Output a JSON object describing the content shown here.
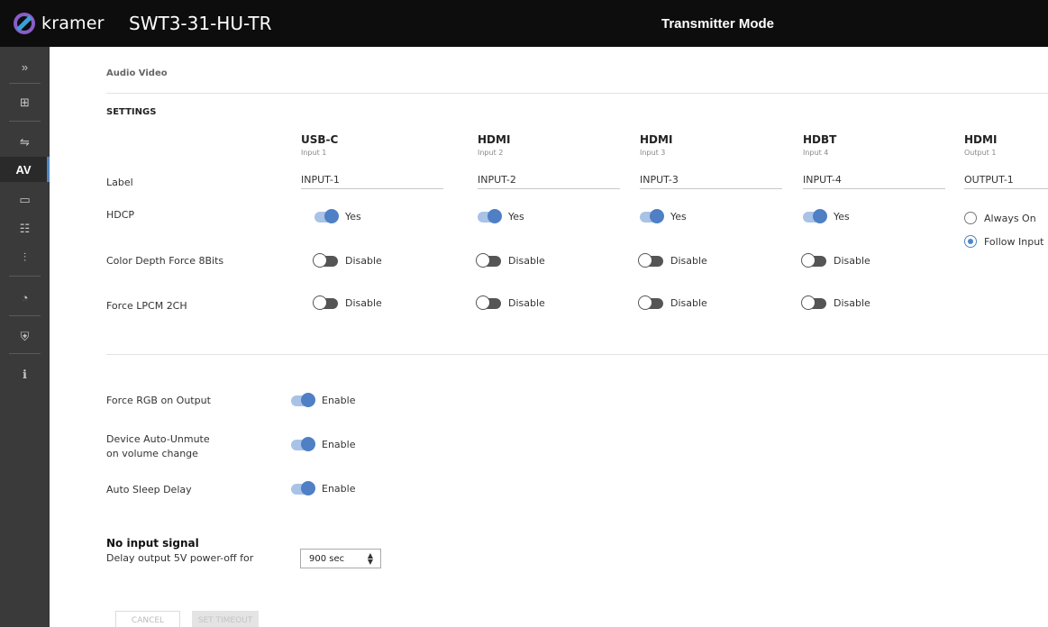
{
  "header": {
    "brand": "kramer",
    "device_name": "SWT3-31-HU-TR",
    "mode": "Transmitter Mode"
  },
  "sidebar": {
    "items": [
      {
        "icon": "chevron-double-right-icon",
        "glyph": "»"
      },
      {
        "icon": "routing-icon",
        "glyph": "⊞"
      },
      {
        "icon": "switching-icon",
        "glyph": "⇋"
      },
      {
        "icon": "av-icon",
        "glyph": "AV",
        "active": true
      },
      {
        "icon": "display-icon",
        "glyph": "▭"
      },
      {
        "icon": "device-settings-icon",
        "glyph": "☷"
      },
      {
        "icon": "audio-settings-icon",
        "glyph": "⫶"
      },
      {
        "icon": "diagnostics-icon",
        "glyph": "◔"
      },
      {
        "icon": "security-icon",
        "glyph": "⛨"
      },
      {
        "icon": "info-icon",
        "glyph": "ℹ"
      }
    ]
  },
  "main": {
    "breadcrumb": "Audio Video",
    "settings_title": "SETTINGS",
    "row_labels": {
      "label": "Label",
      "hdcp": "HDCP",
      "color_depth": "Color Depth Force 8Bits",
      "force_lpcm": "Force LPCM 2CH"
    },
    "columns": [
      {
        "title": "USB-C",
        "subtitle": "Input 1",
        "label_value": "INPUT-1",
        "hdcp": "Yes",
        "color_depth": "Disable",
        "force_lpcm": "Disable"
      },
      {
        "title": "HDMI",
        "subtitle": "Input 2",
        "label_value": "INPUT-2",
        "hdcp": "Yes",
        "color_depth": "Disable",
        "force_lpcm": "Disable"
      },
      {
        "title": "HDMI",
        "subtitle": "Input 3",
        "label_value": "INPUT-3",
        "hdcp": "Yes",
        "color_depth": "Disable",
        "force_lpcm": "Disable"
      },
      {
        "title": "HDBT",
        "subtitle": "Input 4",
        "label_value": "INPUT-4",
        "hdcp": "Yes",
        "color_depth": "Disable",
        "force_lpcm": "Disable"
      }
    ],
    "output_column": {
      "title": "HDMI",
      "subtitle": "Output 1",
      "label_value": "OUTPUT-1",
      "hdcp_options": [
        {
          "label": "Always On",
          "checked": false
        },
        {
          "label": "Follow Input",
          "checked": true
        }
      ]
    },
    "global_settings": [
      {
        "label": "Force RGB on Output",
        "value": "Enable"
      },
      {
        "label_line1": "Device Auto-Unmute",
        "label_line2": "on volume change",
        "value": "Enable"
      },
      {
        "label": "Auto Sleep Delay",
        "value": "Enable"
      }
    ],
    "no_input": {
      "title": "No input signal",
      "description": "Delay output 5V power-off for",
      "value": "900 sec"
    },
    "buttons": {
      "cancel": "CANCEL",
      "set_timeout": "SET TIMEOUT"
    }
  },
  "colors": {
    "accent": "#4f7fc5",
    "topbar": "#0d0d0d",
    "sidebar": "#3a3a3a"
  }
}
